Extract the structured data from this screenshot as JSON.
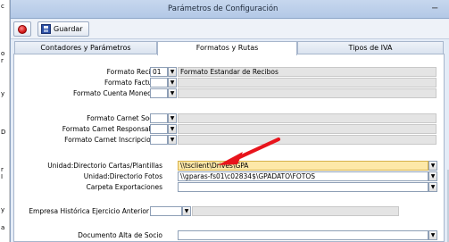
{
  "window": {
    "title": "Parámetros de Configuración",
    "minimize_glyph": "−"
  },
  "left_strip": {
    "chars": [
      "c",
      "o",
      "r",
      "y",
      "D",
      "r",
      "I",
      "y",
      "a"
    ]
  },
  "toolbar": {
    "close_icon": "close-circle-icon",
    "save_icon": "floppy-disk-icon",
    "save_label": "Guardar"
  },
  "tabs": [
    {
      "label": "Contadores y Parámetros",
      "active": false
    },
    {
      "label": "Formatos y Rutas",
      "active": true
    },
    {
      "label": "Tipos de IVA",
      "active": false
    }
  ],
  "form": {
    "formato_recibos": {
      "label": "Formato Recibos",
      "code": "01",
      "description": "Formato Estandar de Recibos"
    },
    "formato_facturas": {
      "label": "Formato Facturas"
    },
    "formato_cuenta_monedero": {
      "label": "Formato Cuenta Monedero"
    },
    "formato_carnet_socios": {
      "label": "Formato Carnet Socios"
    },
    "formato_carnet_responsables": {
      "label": "Formato Carnet Responsables"
    },
    "formato_carnet_inscripciones": {
      "label": "Formato Carnet Inscripciones"
    },
    "dir_cartas": {
      "label": "Unidad:Directorio Cartas/Plantillas",
      "value": "\\\\tsclient\\Drives\\GPA"
    },
    "dir_fotos": {
      "label": "Unidad:Directorio Fotos",
      "value": "\\\\gparas-fs01\\c02834$\\GPADATO\\FOTOS"
    },
    "carpeta_exportaciones": {
      "label": "Carpeta Exportaciones"
    },
    "empresa_historica": {
      "label": "Empresa Histórica Ejercicio Anterior"
    },
    "documento_alta": {
      "label": "Documento Alta de Socio"
    }
  },
  "annotation": {
    "arrow_color": "#e8141c"
  },
  "colors": {
    "highlight_field": "#fde8a8",
    "accent": "#b3c8e6"
  }
}
